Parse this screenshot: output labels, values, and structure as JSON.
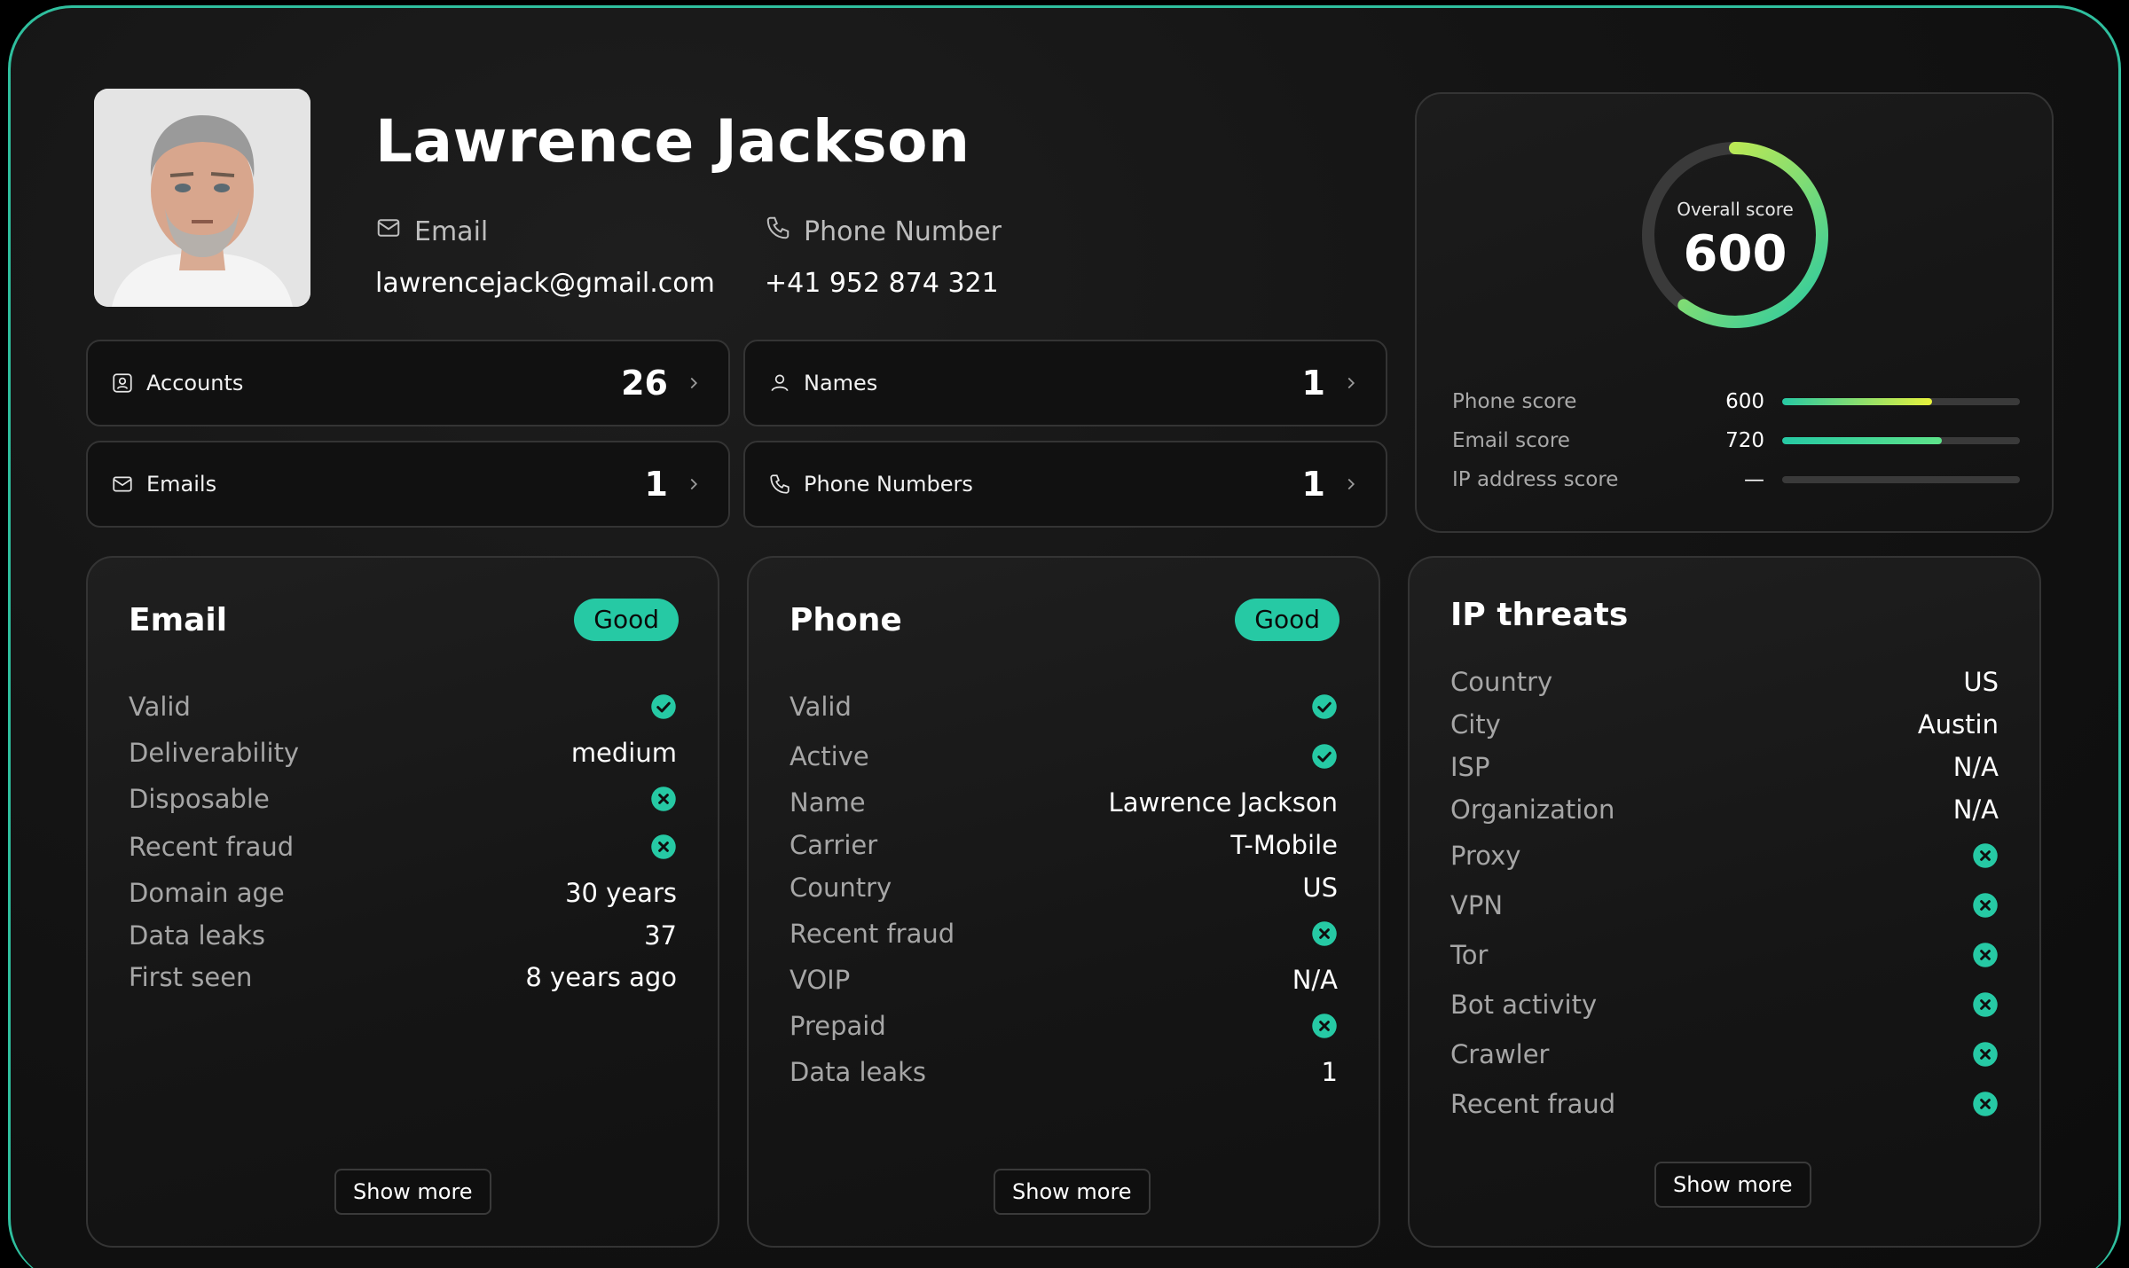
{
  "profile": {
    "name": "Lawrence Jackson",
    "email_label": "Email",
    "email_value": "lawrencejack@gmail.com",
    "phone_label": "Phone Number",
    "phone_value": "+41 952 874 321",
    "icons": {
      "email": "mail-icon",
      "phone": "phone-icon"
    }
  },
  "tiles": [
    {
      "label": "Accounts",
      "count": "26",
      "icon": "account-icon"
    },
    {
      "label": "Names",
      "count": "1",
      "icon": "user-icon"
    },
    {
      "label": "Emails",
      "count": "1",
      "icon": "mail-icon"
    },
    {
      "label": "Phone Numbers",
      "count": "1",
      "icon": "phone-icon"
    }
  ],
  "score": {
    "overall_label": "Overall score",
    "overall_value": "600",
    "overall_fraction": 0.6,
    "rows": [
      {
        "label": "Phone score",
        "value": "600",
        "fraction": 0.63
      },
      {
        "label": "Email score",
        "value": "720",
        "fraction": 0.67
      },
      {
        "label": "IP address score",
        "value": "—",
        "fraction": 0
      }
    ]
  },
  "email_card": {
    "title": "Email",
    "badge": "Good",
    "rows": [
      {
        "label": "Valid",
        "type": "check"
      },
      {
        "label": "Deliverability",
        "value": "medium"
      },
      {
        "label": "Disposable",
        "type": "cross"
      },
      {
        "label": "Recent fraud",
        "type": "cross"
      },
      {
        "label": "Domain age",
        "value": "30 years"
      },
      {
        "label": "Data leaks",
        "value": "37"
      },
      {
        "label": "First seen",
        "value": "8 years ago"
      }
    ],
    "show_more": "Show more"
  },
  "phone_card": {
    "title": "Phone",
    "badge": "Good",
    "rows": [
      {
        "label": "Valid",
        "type": "check"
      },
      {
        "label": "Active",
        "type": "check"
      },
      {
        "label": "Name",
        "value": "Lawrence Jackson"
      },
      {
        "label": "Carrier",
        "value": "T-Mobile"
      },
      {
        "label": "Country",
        "value": "US"
      },
      {
        "label": "Recent fraud",
        "type": "cross"
      },
      {
        "label": "VOIP",
        "value": "N/A"
      },
      {
        "label": "Prepaid",
        "type": "cross"
      },
      {
        "label": "Data leaks",
        "value": "1"
      }
    ],
    "show_more": "Show more"
  },
  "ip_card": {
    "title": "IP threats",
    "rows": [
      {
        "label": "Country",
        "value": "US"
      },
      {
        "label": "City",
        "value": "Austin"
      },
      {
        "label": "ISP",
        "value": "N/A"
      },
      {
        "label": "Organization",
        "value": "N/A"
      },
      {
        "label": "Proxy",
        "type": "cross"
      },
      {
        "label": "VPN",
        "type": "cross"
      },
      {
        "label": "Tor",
        "type": "cross"
      },
      {
        "label": "Bot activity",
        "type": "cross"
      },
      {
        "label": "Crawler",
        "type": "cross"
      },
      {
        "label": "Recent fraud",
        "type": "cross"
      }
    ],
    "show_more": "Show more"
  },
  "colors": {
    "accent": "#26c9a4",
    "frame": "#2fbf9e",
    "gauge_start": "#26c9a4",
    "gauge_end": "#e8f23c"
  }
}
